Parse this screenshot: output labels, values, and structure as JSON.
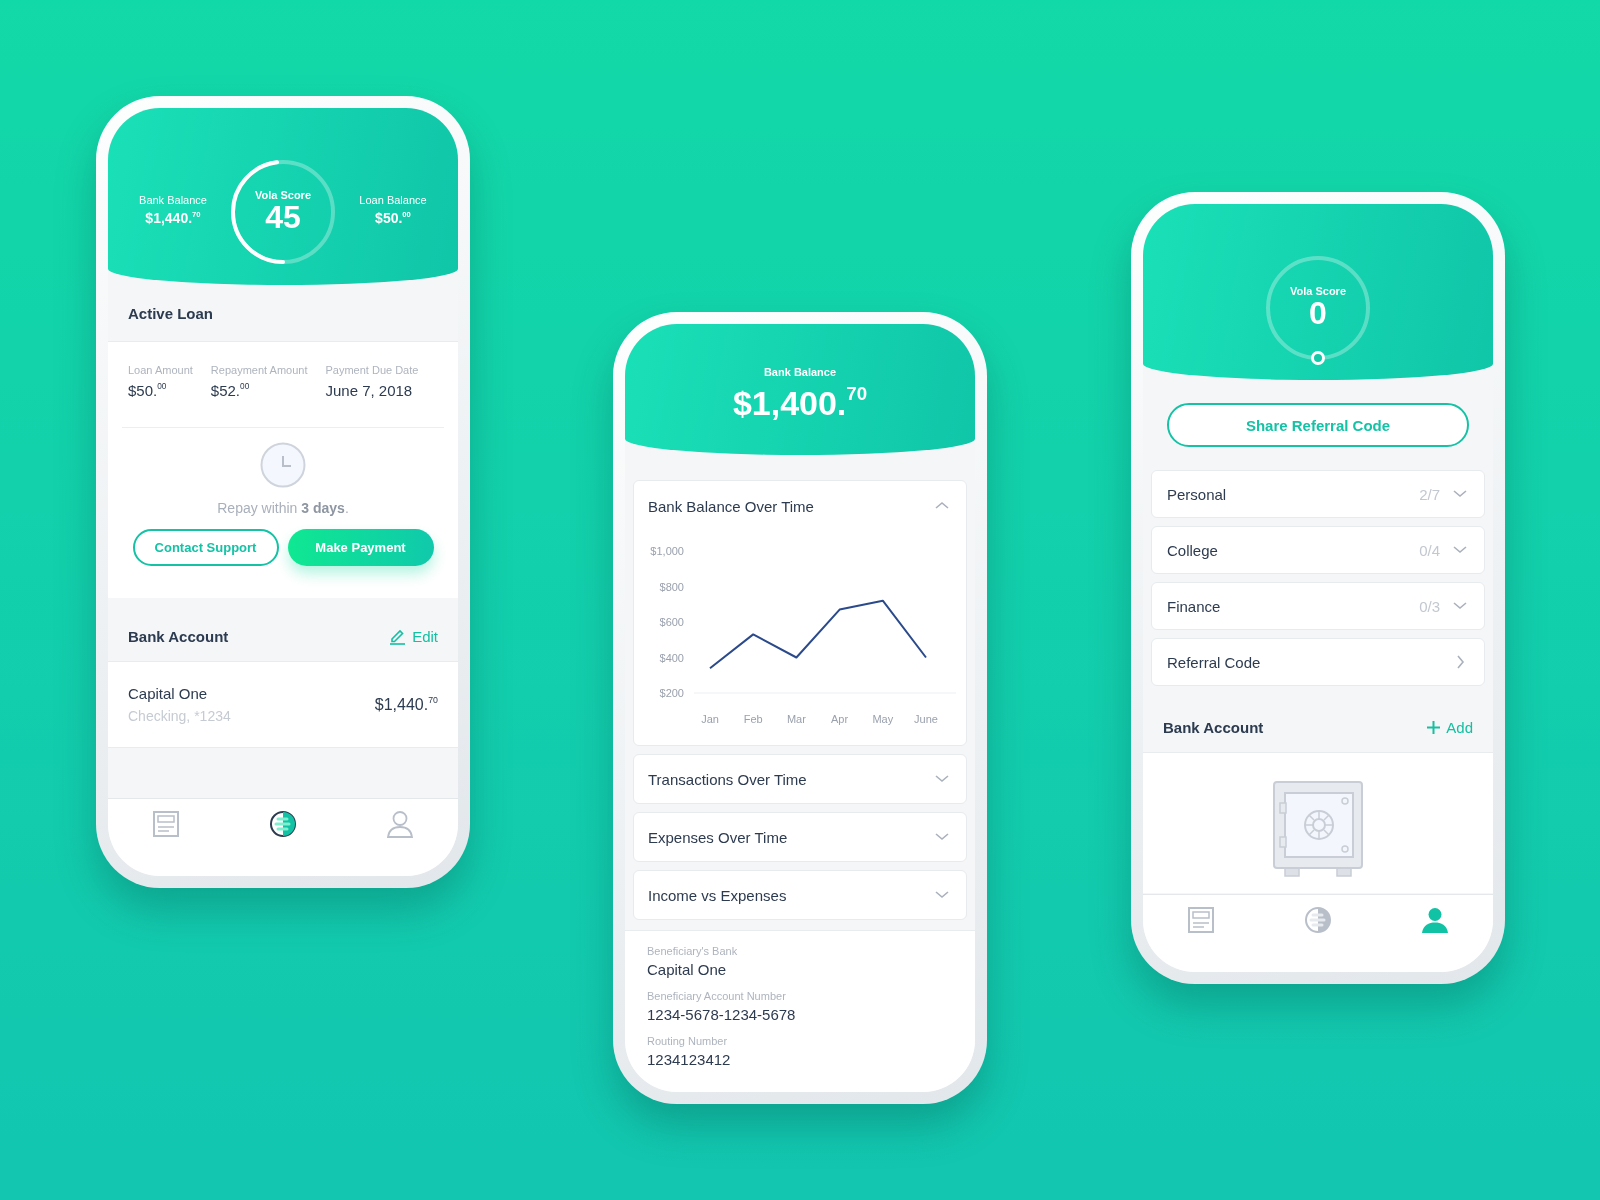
{
  "phones": [
    {
      "kind": "dashboard",
      "header": {
        "bank_balance": {
          "label": "Bank Balance",
          "value": "$1,440.$^{70}$"
        },
        "score": {
          "label": "Vola Score",
          "value": "45",
          "level": 0.48
        },
        "loan_balance": {
          "label": "Loan Balance",
          "value": "$50.$^{00}$"
        }
      },
      "active_loan": {
        "title": "Active Loan",
        "fields": [
          {
            "label": "Loan Amount",
            "value": "$50.$^{00}$"
          },
          {
            "label": "Repayment Amount",
            "value": "$52.$^{00}$"
          },
          {
            "label": "Payment Due Date",
            "value": "June 7, 2018"
          }
        ],
        "note": "Repay within **3 days**.",
        "buttons": [
          {
            "label": "Contact Support",
            "kind": "outline"
          },
          {
            "label": "Make Payment",
            "kind": "filled"
          }
        ]
      },
      "bank_account": {
        "title": "Bank Account",
        "action": "Edit",
        "bank": "Capital One",
        "account": "Checking, *1234",
        "amount": "$1,440.$^{70}$"
      },
      "tab_bar": [
        {
          "kind": "statement",
          "selected": false
        },
        {
          "kind": "score",
          "selected": true
        },
        {
          "kind": "profile",
          "selected": false
        }
      ]
    },
    {
      "kind": "balance",
      "header": {
        "label": "Bank Balance",
        "value": "$1,400.$^{70}$"
      },
      "sections": [
        {
          "title": "Bank Balance Over Time",
          "expanded": true,
          "chart_data": {
            "type": "line",
            "categories": [
              "Jan",
              "Feb",
              "Mar",
              "Apr",
              "May",
              "June"
            ],
            "series": [
              {
                "color": "#2b4a8b",
                "values": [
                  340,
                  530,
                  400,
                  670,
                  720,
                  400
                ]
              }
            ],
            "ylim": [
              200,
              1000
            ],
            "yticks": [
              {
                "value": 200,
                "label": "$200"
              },
              {
                "value": 400,
                "label": "$400"
              },
              {
                "value": 600,
                "label": "$600"
              },
              {
                "value": 800,
                "label": "$800"
              },
              {
                "value": 1000,
                "label": "$1,000"
              }
            ]
          }
        },
        {
          "title": "Transactions Over Time",
          "expanded": false
        },
        {
          "title": "Expenses Over Time",
          "expanded": false
        },
        {
          "title": "Income vs Expenses",
          "expanded": false
        }
      ],
      "details": [
        {
          "label": "Beneficiary's Bank",
          "value": "Capital One"
        },
        {
          "label": "Beneficiary Account Number",
          "value": "1234-5678-1234-5678"
        },
        {
          "label": "Routing Number",
          "value": "1234123412"
        }
      ]
    },
    {
      "kind": "profile",
      "score": {
        "label": "Vola Score",
        "value": "0",
        "level": 0
      },
      "share_button": "Share Referral Code",
      "items": [
        {
          "kind": "dropdown",
          "label": "Personal",
          "progress": "2/7"
        },
        {
          "kind": "dropdown",
          "label": "College",
          "progress": "0/4"
        },
        {
          "kind": "dropdown",
          "label": "Finance",
          "progress": "0/3"
        },
        {
          "kind": "link",
          "label": "Referral Code"
        }
      ],
      "bank_account": {
        "title": "Bank Account",
        "action": "Add"
      },
      "tab_bar": [
        {
          "kind": "statement",
          "selected": false
        },
        {
          "kind": "score",
          "selected": false
        },
        {
          "kind": "profile",
          "selected": true
        }
      ]
    }
  ]
}
